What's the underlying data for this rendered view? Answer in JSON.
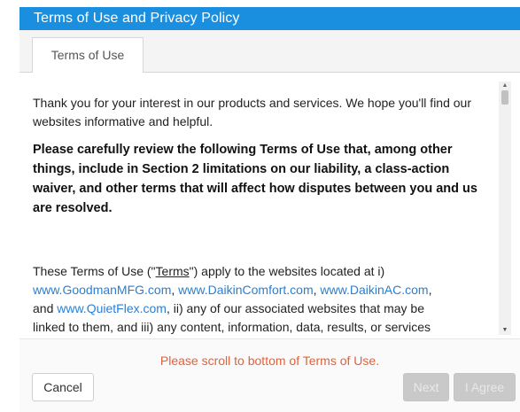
{
  "dialog": {
    "title": "Terms of Use and Privacy Policy"
  },
  "tabs": [
    {
      "label": "Terms of Use"
    }
  ],
  "content": {
    "intro": "Thank you for your interest in our products and services.  We hope you'll find our websites informative and helpful.",
    "review_notice": "Please carefully review the following Terms of Use that, among other things, include in Section 2 limitations on our liability, a class-action waiver, and other terms that will affect how disputes between you and us are resolved.",
    "terms_pre": "These Terms of Use (\"",
    "terms_word": "Terms",
    "terms_post": "\") apply to the websites located at i)",
    "link_goodman": "www.GoodmanMFG.com",
    "link_daikincomfort": "www.DaikinComfort.com",
    "link_daikinac": "www.DaikinAC.com",
    "and_text": "and",
    "link_quietflex": "www.QuietFlex.com",
    "terms_cont_1": ", ii) any of our associated websites that may be",
    "terms_cont_2": "linked to them, and iii) any content, information, data, results, or services",
    "sep_comma": ",",
    "sep_comma_end": ","
  },
  "footer": {
    "scroll_message": "Please scroll to bottom of Terms of Use.",
    "cancel_label": "Cancel",
    "next_label": "Next",
    "agree_label": "I Agree"
  },
  "colors": {
    "titlebar": "#1a8fe0",
    "link": "#2a7fd4",
    "warning": "#e0623a",
    "disabled_button": "#c9c9c9"
  }
}
